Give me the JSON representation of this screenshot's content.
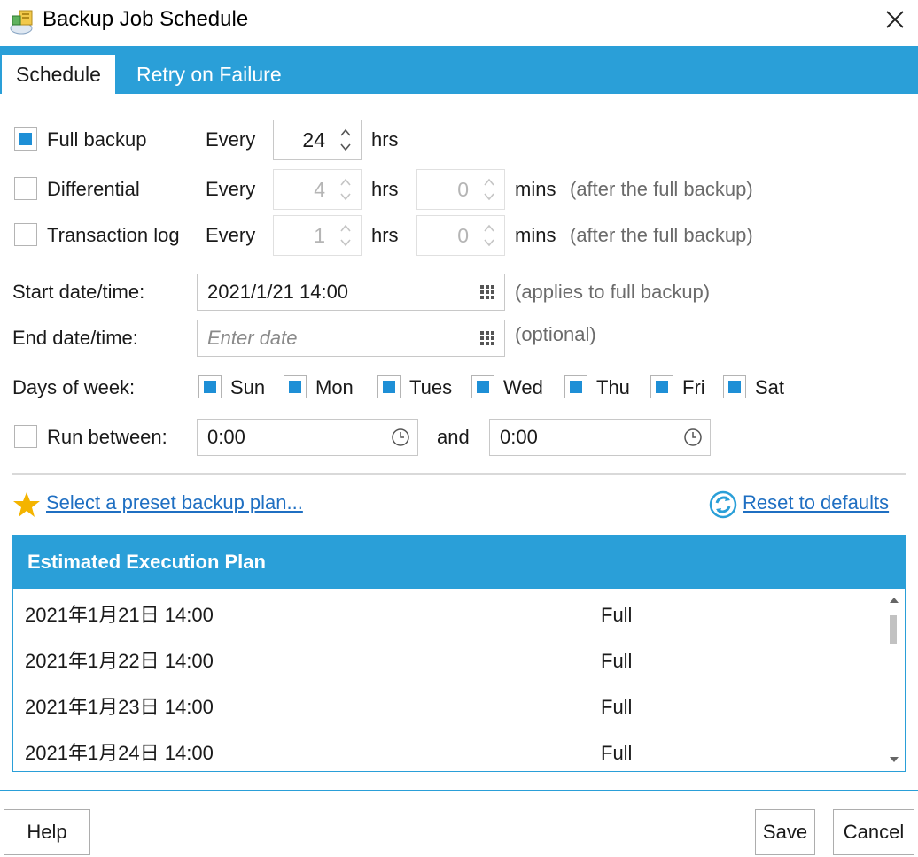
{
  "window": {
    "title": "Backup Job Schedule"
  },
  "tabs": [
    {
      "label": "Schedule",
      "active": true
    },
    {
      "label": "Retry on Failure",
      "active": false
    }
  ],
  "schedule": {
    "full_backup": {
      "label": "Full backup",
      "checked": true,
      "every_label": "Every",
      "hrs_value": "24",
      "hrs_unit": "hrs"
    },
    "differential": {
      "label": "Differential",
      "checked": false,
      "every_label": "Every",
      "hrs_value": "4",
      "hrs_unit": "hrs",
      "mins_value": "0",
      "mins_unit": "mins",
      "note": "(after the full backup)"
    },
    "transaction_log": {
      "label": "Transaction log",
      "checked": false,
      "every_label": "Every",
      "hrs_value": "1",
      "hrs_unit": "hrs",
      "mins_value": "0",
      "mins_unit": "mins",
      "note": "(after the full backup)"
    },
    "start": {
      "label": "Start date/time:",
      "value": "2021/1/21 14:00",
      "note": "(applies to full backup)"
    },
    "end": {
      "label": "End date/time:",
      "placeholder": "Enter date",
      "note": "(optional)"
    },
    "days": {
      "label": "Days of week:",
      "items": [
        {
          "label": "Sun",
          "checked": true
        },
        {
          "label": "Mon",
          "checked": true
        },
        {
          "label": "Tues",
          "checked": true
        },
        {
          "label": "Wed",
          "checked": true
        },
        {
          "label": "Thu",
          "checked": true
        },
        {
          "label": "Fri",
          "checked": true
        },
        {
          "label": "Sat",
          "checked": true
        }
      ]
    },
    "run_between": {
      "label": "Run between:",
      "checked": false,
      "from": "0:00",
      "and_label": "and",
      "to": "0:00"
    }
  },
  "links": {
    "preset": "Select a preset backup plan...",
    "reset": "Reset to defaults"
  },
  "plan": {
    "title": "Estimated Execution Plan",
    "rows": [
      {
        "date": "2021年1月21日 14:00",
        "type": "Full"
      },
      {
        "date": "2021年1月22日 14:00",
        "type": "Full"
      },
      {
        "date": "2021年1月23日 14:00",
        "type": "Full"
      },
      {
        "date": "2021年1月24日 14:00",
        "type": "Full"
      }
    ]
  },
  "buttons": {
    "help": "Help",
    "save": "Save",
    "cancel": "Cancel"
  },
  "colors": {
    "accent": "#2a9fd8",
    "checkbox": "#1e8fd6",
    "link": "#1f6fc2",
    "star": "#f4b400"
  }
}
